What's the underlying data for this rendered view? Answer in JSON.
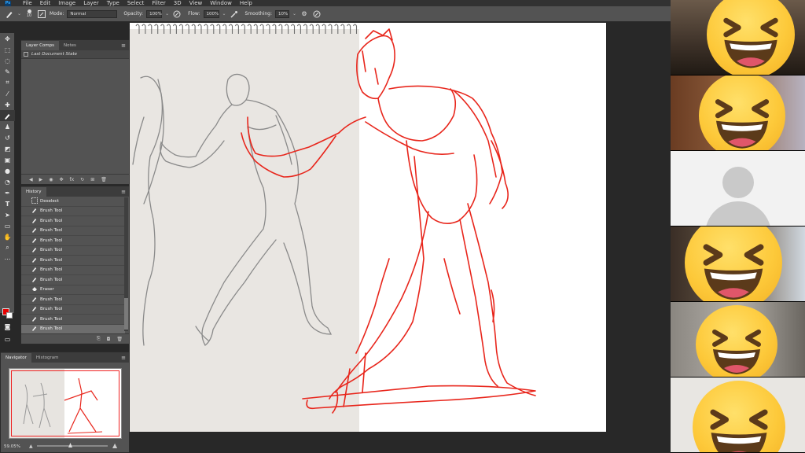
{
  "menubar": {
    "logo": "Ps",
    "items": [
      "File",
      "Edit",
      "Image",
      "Layer",
      "Type",
      "Select",
      "Filter",
      "3D",
      "View",
      "Window",
      "Help"
    ]
  },
  "options": {
    "brush_size": "10",
    "mode_label": "Mode:",
    "mode_value": "Normal",
    "opacity_label": "Opacity:",
    "opacity_value": "100%",
    "flow_label": "Flow:",
    "flow_value": "100%",
    "smoothing_label": "Smoothing:",
    "smoothing_value": "10%"
  },
  "layer_comps": {
    "tabs": [
      "Layer Comps",
      "Notes"
    ],
    "row_label": "Last Document State"
  },
  "history": {
    "tab": "History",
    "items": [
      {
        "label": "Deselect",
        "icon": "deselect-icon"
      },
      {
        "label": "Brush Tool",
        "icon": "brush-icon"
      },
      {
        "label": "Brush Tool",
        "icon": "brush-icon"
      },
      {
        "label": "Brush Tool",
        "icon": "brush-icon"
      },
      {
        "label": "Brush Tool",
        "icon": "brush-icon"
      },
      {
        "label": "Brush Tool",
        "icon": "brush-icon"
      },
      {
        "label": "Brush Tool",
        "icon": "brush-icon"
      },
      {
        "label": "Brush Tool",
        "icon": "brush-icon"
      },
      {
        "label": "Brush Tool",
        "icon": "brush-icon"
      },
      {
        "label": "Eraser",
        "icon": "eraser-icon"
      },
      {
        "label": "Brush Tool",
        "icon": "brush-icon"
      },
      {
        "label": "Brush Tool",
        "icon": "brush-icon"
      },
      {
        "label": "Brush Tool",
        "icon": "brush-icon"
      },
      {
        "label": "Brush Tool",
        "icon": "brush-icon"
      }
    ]
  },
  "navigator": {
    "tabs": [
      "Navigator",
      "Histogram"
    ],
    "zoom": "59.05%"
  },
  "colors": {
    "foreground": "#e60000",
    "background": "#ffffff",
    "sketch_red": "#e8261c",
    "pencil_gray": "#8a8a8a"
  }
}
